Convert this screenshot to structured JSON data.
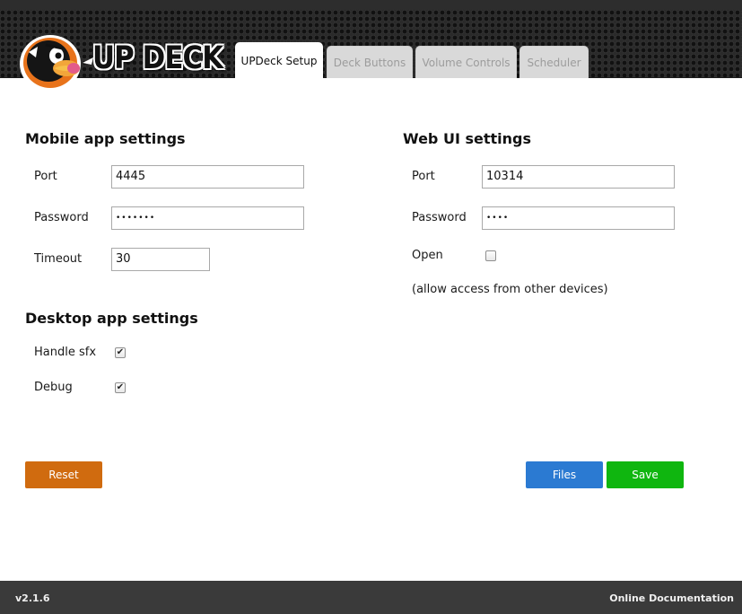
{
  "header": {
    "logo_text": "UP DECK",
    "tabs": [
      {
        "label": "UPDeck Setup",
        "active": true
      },
      {
        "label": "Deck Buttons",
        "active": false
      },
      {
        "label": "Volume Controls",
        "active": false
      },
      {
        "label": "Scheduler",
        "active": false
      }
    ]
  },
  "mobile": {
    "title": "Mobile app settings",
    "port_label": "Port",
    "port_value": "4445",
    "password_label": "Password",
    "password_value": "•••••••",
    "timeout_label": "Timeout",
    "timeout_value": "30"
  },
  "desktop": {
    "title": "Desktop app settings",
    "handle_sfx_label": "Handle sfx",
    "handle_sfx_checked": true,
    "debug_label": "Debug",
    "debug_checked": true
  },
  "webui": {
    "title": "Web UI settings",
    "port_label": "Port",
    "port_value": "10314",
    "password_label": "Password",
    "password_value": "••••",
    "open_label": "Open",
    "open_checked": false,
    "note": "(allow access from other devices)"
  },
  "actions": {
    "reset_label": "Reset",
    "files_label": "Files",
    "save_label": "Save",
    "reset_color": "#d06b0f",
    "files_color": "#2b7ad2",
    "save_color": "#0fb60f"
  },
  "footer": {
    "version": "v2.1.6",
    "docs_link": "Online Documentation"
  }
}
